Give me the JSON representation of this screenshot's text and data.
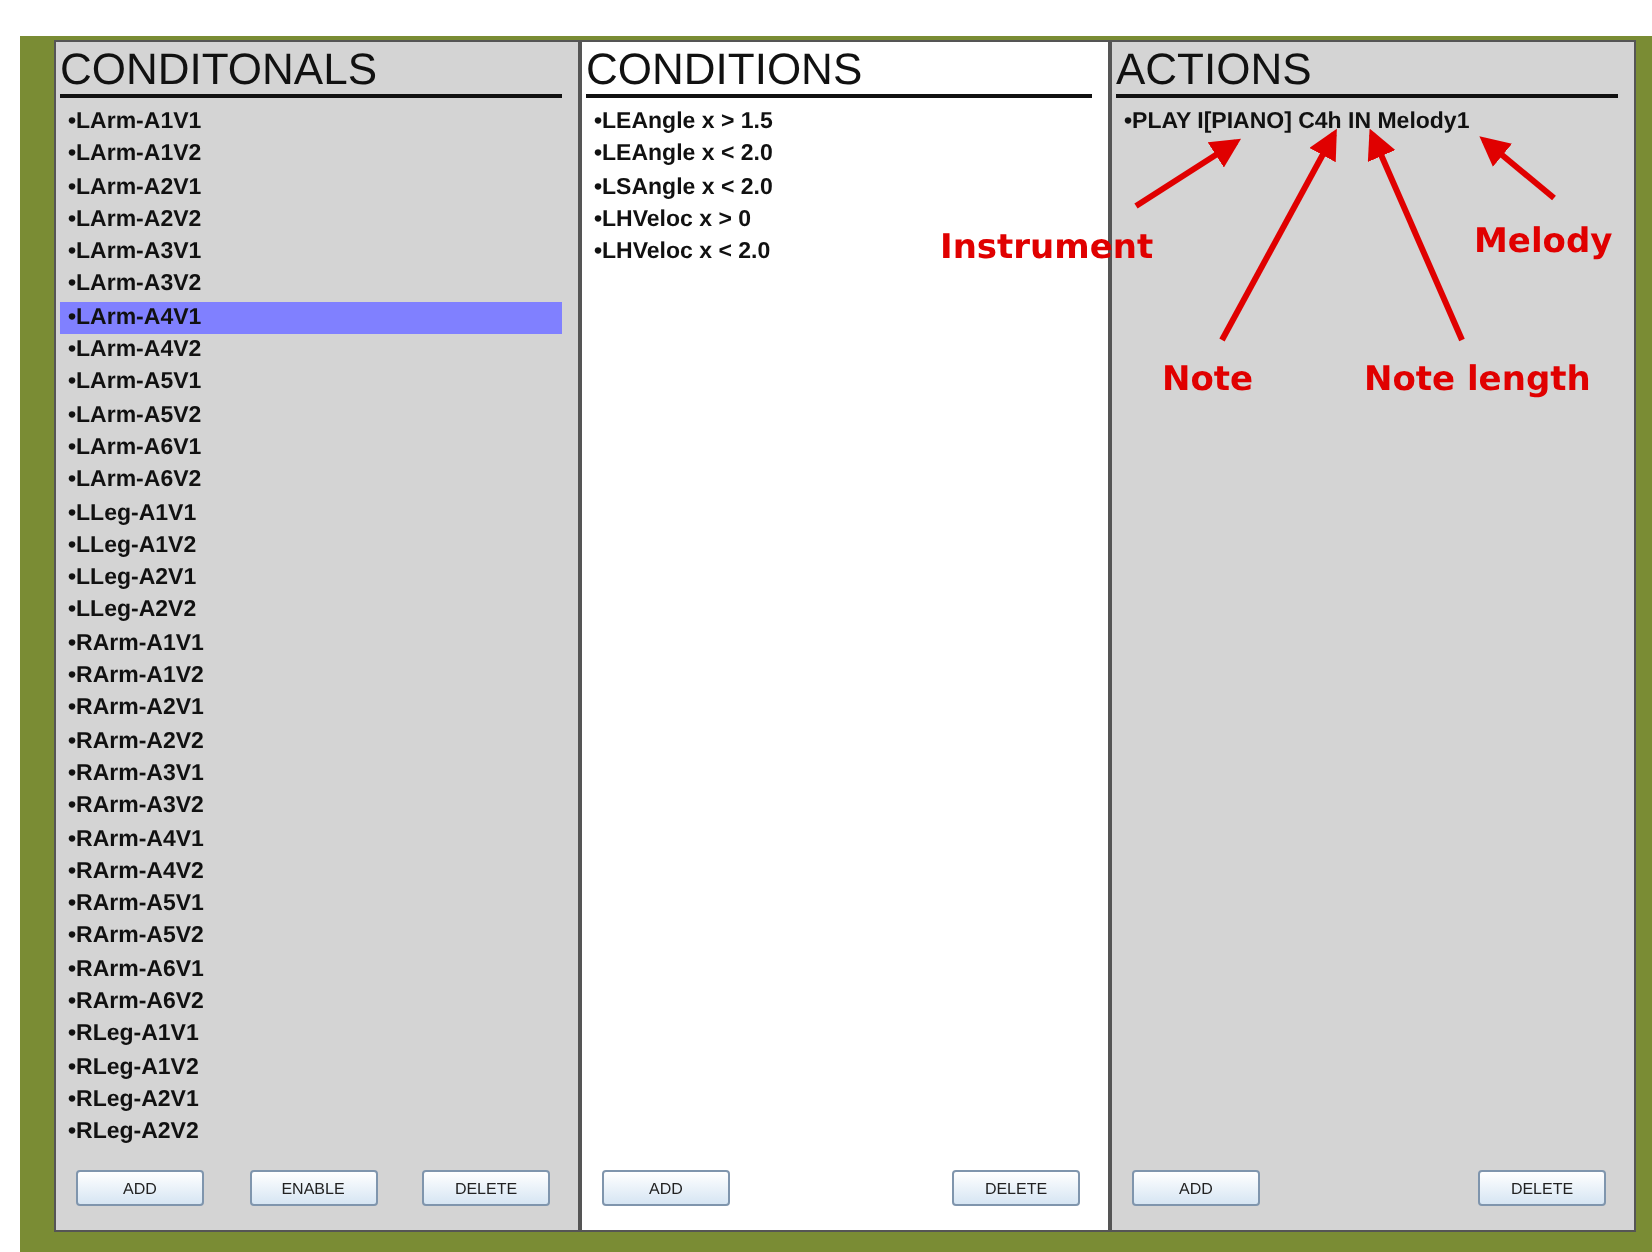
{
  "panels": [
    {
      "title": "CONDITONALS",
      "color": "#d4d4d4",
      "items": [
        {
          "label": "•LArm-A1V1",
          "selected": false
        },
        {
          "label": "•LArm-A1V2",
          "selected": false
        },
        {
          "label": "•LArm-A2V1",
          "selected": false
        },
        {
          "label": "•LArm-A2V2",
          "selected": false
        },
        {
          "label": "•LArm-A3V1",
          "selected": false
        },
        {
          "label": "•LArm-A3V2",
          "selected": false
        },
        {
          "label": "•LArm-A4V1",
          "selected": true
        },
        {
          "label": "•LArm-A4V2",
          "selected": false
        },
        {
          "label": "•LArm-A5V1",
          "selected": false
        },
        {
          "label": "•LArm-A5V2",
          "selected": false
        },
        {
          "label": "•LArm-A6V1",
          "selected": false
        },
        {
          "label": "•LArm-A6V2",
          "selected": false
        },
        {
          "label": "•LLeg-A1V1",
          "selected": false
        },
        {
          "label": "•LLeg-A1V2",
          "selected": false
        },
        {
          "label": "•LLeg-A2V1",
          "selected": false
        },
        {
          "label": "•LLeg-A2V2",
          "selected": false
        },
        {
          "label": "•RArm-A1V1",
          "selected": false
        },
        {
          "label": "•RArm-A1V2",
          "selected": false
        },
        {
          "label": "•RArm-A2V1",
          "selected": false
        },
        {
          "label": "•RArm-A2V2",
          "selected": false
        },
        {
          "label": "•RArm-A3V1",
          "selected": false
        },
        {
          "label": "•RArm-A3V2",
          "selected": false
        },
        {
          "label": "•RArm-A4V1",
          "selected": false
        },
        {
          "label": "•RArm-A4V2",
          "selected": false
        },
        {
          "label": "•RArm-A5V1",
          "selected": false
        },
        {
          "label": "•RArm-A5V2",
          "selected": false
        },
        {
          "label": "•RArm-A6V1",
          "selected": false
        },
        {
          "label": "•RArm-A6V2",
          "selected": false
        },
        {
          "label": "•RLeg-A1V1",
          "selected": false
        },
        {
          "label": "•RLeg-A1V2",
          "selected": false
        },
        {
          "label": "•RLeg-A2V1",
          "selected": false
        },
        {
          "label": "•RLeg-A2V2",
          "selected": false
        }
      ],
      "buttons": [
        "ADD",
        "ENABLE",
        "DELETE"
      ]
    },
    {
      "title": "CONDITIONS",
      "color": "#ffffff",
      "items": [
        {
          "label": "•LEAngle x > 1.5",
          "selected": false
        },
        {
          "label": "•LEAngle x < 2.0",
          "selected": false
        },
        {
          "label": "•LSAngle x < 2.0",
          "selected": false
        },
        {
          "label": "•LHVeloc x > 0",
          "selected": false
        },
        {
          "label": "•LHVeloc x < 2.0",
          "selected": false
        }
      ],
      "buttons": [
        "ADD",
        "DELETE"
      ]
    },
    {
      "title": "ACTIONS",
      "color": "#d4d4d4",
      "items": [
        {
          "label": "•PLAY I[PIANO] C4h IN Melody1",
          "selected": false
        }
      ],
      "buttons": [
        "ADD",
        "DELETE"
      ]
    }
  ],
  "annotations": [
    {
      "label": "Instrument"
    },
    {
      "label": "Melody"
    },
    {
      "label": "Note"
    },
    {
      "label": "Note length"
    }
  ]
}
